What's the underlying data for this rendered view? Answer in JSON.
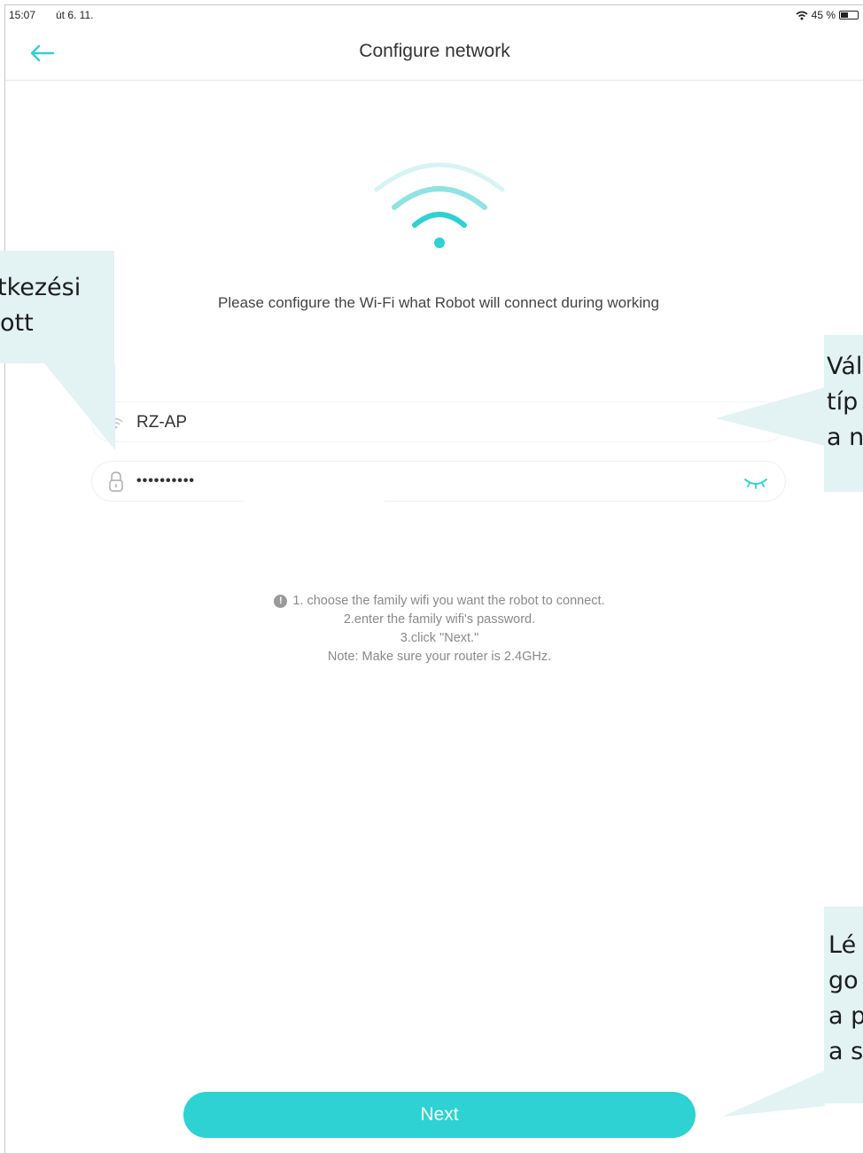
{
  "status_bar": {
    "time": "15:07",
    "date": "út 6. 11.",
    "battery_percent": "45 %",
    "battery_level": 0.45
  },
  "nav": {
    "title": "Configure network"
  },
  "main": {
    "prompt": "Please configure the Wi-Fi what Robot will connect during working",
    "ssid": {
      "value": "RZ-AP"
    },
    "password": {
      "value": "••••••••••"
    },
    "help": {
      "line1": "1. choose the family wifi you want the robot to connect.",
      "line2": "2.enter the family wifi's password.",
      "line3": "3.click \"Next.\"",
      "line4": "Note: Make sure your router is 2.4GHz."
    },
    "next_label": "Next"
  },
  "callouts": {
    "left": {
      "line1": "tkezési",
      "line2": "ott"
    },
    "right_top": {
      "line1": "Vál",
      "line2": "típ",
      "line3": "a n"
    },
    "right_bottom": {
      "line1": "Lé",
      "line2": "go",
      "line3": "a p",
      "line4": "a s"
    }
  },
  "colors": {
    "accent": "#2ed2d2",
    "callout_bg": "#e3f2f3"
  }
}
